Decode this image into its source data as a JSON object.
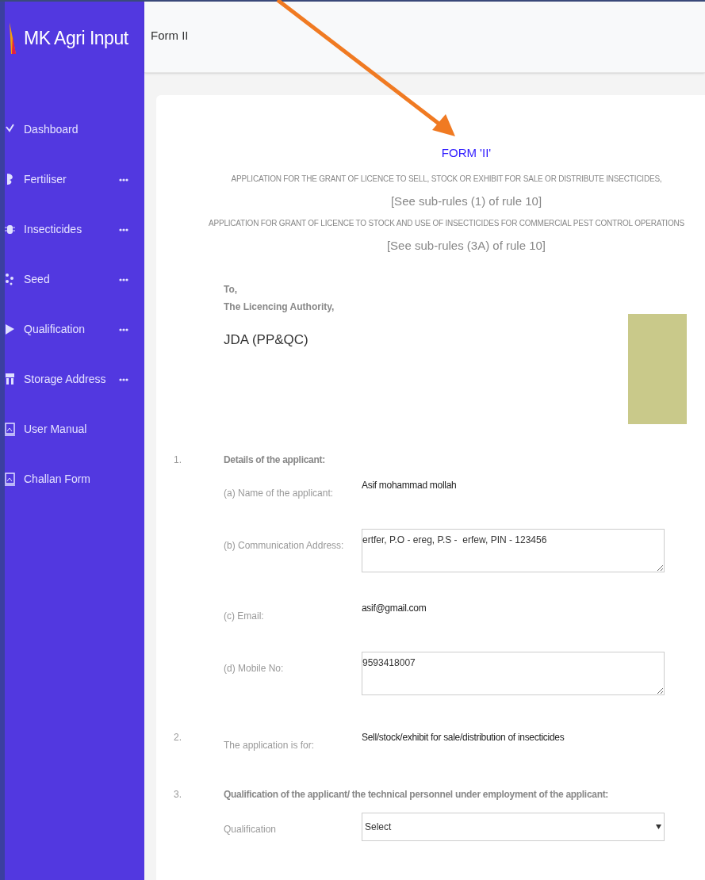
{
  "brand": {
    "name": "MK Agri Input"
  },
  "sidebar": {
    "items": [
      {
        "label": "Dashboard",
        "has_submenu": false
      },
      {
        "label": "Fertiliser",
        "has_submenu": true
      },
      {
        "label": "Insecticides",
        "has_submenu": true
      },
      {
        "label": "Seed",
        "has_submenu": true
      },
      {
        "label": "Qualification",
        "has_submenu": true
      },
      {
        "label": "Storage Address",
        "has_submenu": true
      },
      {
        "label": "User Manual",
        "has_submenu": false
      },
      {
        "label": "Challan Form",
        "has_submenu": false
      }
    ]
  },
  "header": {
    "title": "Form II"
  },
  "form": {
    "title": "FORM 'II'",
    "subtitles": [
      {
        "kind": "caption",
        "text": "APPLICATION FOR THE GRANT OF LICENCE TO SELL, STOCK OR EXHIBIT FOR SALE OR DISTRIBUTE INSECTICIDES,"
      },
      {
        "kind": "rule",
        "text": "[See sub-rules (1) of rule 10]"
      },
      {
        "kind": "caption",
        "text": "APPLICATION FOR GRANT OF LICENCE TO STOCK AND USE OF INSECTICIDES FOR COMMERCIAL PEST CONTROL OPERATIONS"
      },
      {
        "kind": "rule",
        "text": "[See sub-rules (3A) of rule 10]"
      }
    ],
    "to": "To,",
    "authority": "The Licencing Authority,",
    "office": "JDA (PP&QC)",
    "sections": [
      {
        "number": "1.",
        "heading": "Details of the applicant:",
        "fields": [
          {
            "kind": "text",
            "label": "(a) Name of the applicant:",
            "value": "Asif mohammad mollah"
          },
          {
            "kind": "textarea",
            "label": "(b) Communication Address:",
            "value": "ertfer, P.O - ereg, P.S -  erfew, PIN - 123456"
          },
          {
            "kind": "text",
            "label": "(c) Email:",
            "value": "asif@gmail.com"
          },
          {
            "kind": "textarea",
            "label": "(d) Mobile No:",
            "value": "9593418007"
          }
        ]
      },
      {
        "number": "2.",
        "fields": [
          {
            "kind": "text",
            "label": "The application is for:",
            "value": "Sell/stock/exhibit for sale/distribution of insecticides"
          }
        ]
      },
      {
        "number": "3.",
        "heading": "Qualification of the applicant/ the technical personnel under employment of the applicant:",
        "fields": [
          {
            "kind": "select",
            "label": "Qualification",
            "value": "Select"
          }
        ]
      }
    ]
  }
}
